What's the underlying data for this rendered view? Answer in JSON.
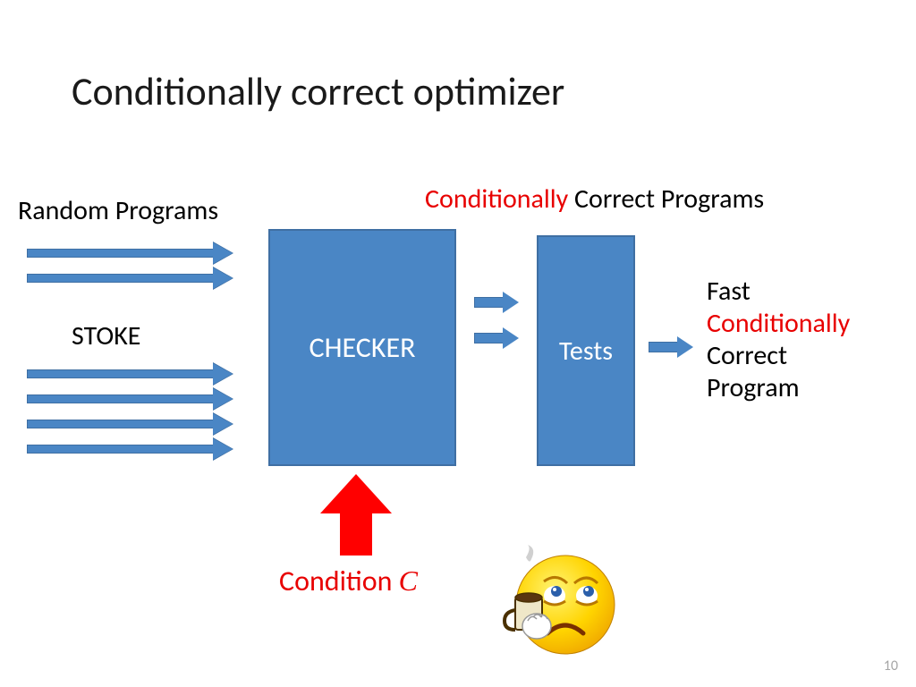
{
  "title": "Conditionally correct optimizer",
  "labels": {
    "random_programs": "Random Programs",
    "stoke": "STOKE",
    "conditionally": "Conditionally",
    "correct_programs": " Correct Programs",
    "checker": "CHECKER",
    "tests": "Tests",
    "output_fast": "Fast",
    "output_cond": "Conditionally",
    "output_correct": "Correct",
    "output_program": "Program",
    "condition_word": "Condition ",
    "condition_var": "C"
  },
  "page_number": "10",
  "colors": {
    "box_fill": "#4a86c5",
    "box_border": "#3f6fa3",
    "red": "#e80000",
    "arrow_red": "#ff0000"
  }
}
